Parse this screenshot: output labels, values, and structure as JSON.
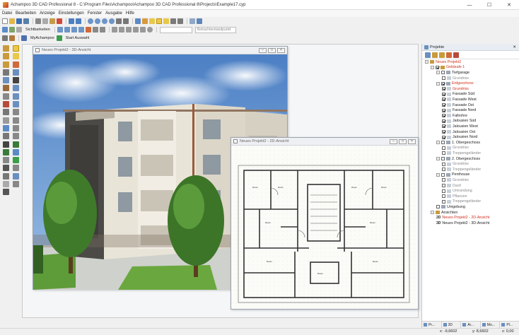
{
  "window": {
    "title": "Achampoo 3D CAD Professional 8 - C:\\Program Files\\Achampoo\\Achampoo 3D CAD Professional 8\\Projects\\Example17.cyp",
    "minimize": "—",
    "maximize": "☐",
    "close": "✕"
  },
  "menu": [
    "Datei",
    "Bearbeiten",
    "Anzeige",
    "Einstellungen",
    "Fenster",
    "Ausgabe",
    "Hilfe"
  ],
  "toolbar": {
    "visibility_label": "Sichtbarkeiten",
    "viewpoint_placeholder": "Betrachterstandpunkt",
    "myachampoo_label": "MyAchampoo",
    "start_label": "Start Auswahl"
  },
  "windows": {
    "view3d_title": "Neues Projekt2 - 3D-Ansicht",
    "view2d_title": "Neues Projekt2 - 2D-Ansicht"
  },
  "panel": {
    "title": "Projekte",
    "close": "✕",
    "tree": [
      {
        "label": "Neues Projekt2",
        "level": 0,
        "color": "red",
        "toggle": "−"
      },
      {
        "label": "Gebäude 1",
        "level": 1,
        "color": "red",
        "toggle": "−",
        "check": true
      },
      {
        "label": "Tiefgarage",
        "level": 2,
        "color": "normal",
        "toggle": "−",
        "check": false
      },
      {
        "label": "Grundriss",
        "level": 3,
        "color": "grey",
        "check": false
      },
      {
        "label": "Erdgeschoss",
        "level": 2,
        "color": "red",
        "toggle": "−",
        "check": true
      },
      {
        "label": "Grundriss",
        "level": 3,
        "color": "red",
        "check": true
      },
      {
        "label": "Fassade Süd",
        "level": 3,
        "color": "normal",
        "check": true
      },
      {
        "label": "Fassade West",
        "level": 3,
        "color": "normal",
        "check": true
      },
      {
        "label": "Fassade Ost",
        "level": 3,
        "color": "normal",
        "check": true
      },
      {
        "label": "Fassade Nord",
        "level": 3,
        "color": "normal",
        "check": true
      },
      {
        "label": "Fallrohre",
        "level": 3,
        "color": "normal",
        "check": true
      },
      {
        "label": "Jalousien Süd",
        "level": 3,
        "color": "normal",
        "check": true
      },
      {
        "label": "Jalousien West",
        "level": 3,
        "color": "normal",
        "check": true
      },
      {
        "label": "Jalousien Ost",
        "level": 3,
        "color": "normal",
        "check": true
      },
      {
        "label": "Jalousien Nord",
        "level": 3,
        "color": "normal",
        "check": true
      },
      {
        "label": "1. Obergeschoss",
        "level": 2,
        "color": "normal",
        "toggle": "−",
        "check": false
      },
      {
        "label": "Grundriss",
        "level": 3,
        "color": "grey",
        "check": false
      },
      {
        "label": "Treppengeländer",
        "level": 3,
        "color": "grey",
        "check": false
      },
      {
        "label": "2. Obergeschoss",
        "level": 2,
        "color": "normal",
        "toggle": "−",
        "check": false
      },
      {
        "label": "Grundriss",
        "level": 3,
        "color": "grey",
        "check": false
      },
      {
        "label": "Treppengeländer",
        "level": 3,
        "color": "grey",
        "check": false
      },
      {
        "label": "Penthouse",
        "level": 2,
        "color": "normal",
        "toggle": "−",
        "check": false
      },
      {
        "label": "Grundriss",
        "level": 3,
        "color": "grey",
        "check": false
      },
      {
        "label": "Dach",
        "level": 3,
        "color": "grey",
        "check": false
      },
      {
        "label": "Umrandung",
        "level": 3,
        "color": "grey",
        "check": false
      },
      {
        "label": "Pflanzen",
        "level": 3,
        "color": "grey",
        "check": false
      },
      {
        "label": "Treppengeländer",
        "level": 3,
        "color": "grey",
        "check": false
      },
      {
        "label": "Umgebung",
        "level": 2,
        "color": "normal",
        "check": false
      },
      {
        "label": "Ansichten",
        "level": 1,
        "color": "normal",
        "toggle": "−"
      },
      {
        "label": "Neues Projekt2 - 2D-Ansicht",
        "level": 2,
        "color": "red",
        "prefix": "2D"
      },
      {
        "label": "Neues Projekt2 - 3D-Ansicht",
        "level": 2,
        "color": "normal",
        "prefix": "3D"
      }
    ],
    "tabs": [
      "Pr...",
      "3D",
      "Ar...",
      "Mo...",
      "Pl..."
    ]
  },
  "status": {
    "x": "x: -9,6602",
    "y": "y: 8,6602",
    "z": "z: 0,00"
  },
  "plan": {
    "room_label": "Raum"
  },
  "colors": {
    "accent_red": "#d0301c",
    "panel_header": "#e8edf3"
  }
}
